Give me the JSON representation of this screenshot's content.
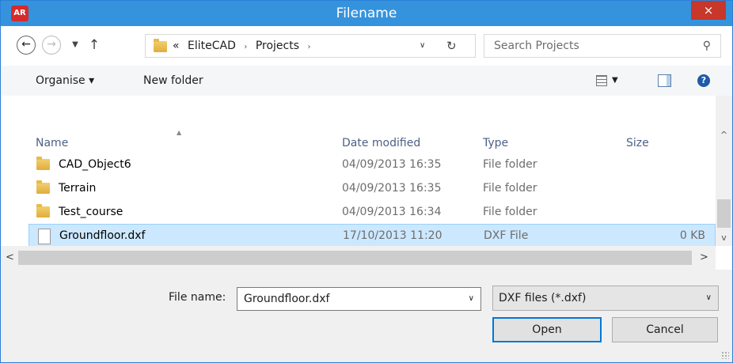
{
  "titlebar": {
    "title": "Filename",
    "app_icon_text": "AR",
    "close_glyph": "×"
  },
  "nav": {
    "back_glyph": "←",
    "forward_glyph": "→",
    "recent_glyph": "▼",
    "up_glyph": "↑"
  },
  "address": {
    "prefix": "«",
    "crumbs": [
      "EliteCAD",
      "Projects"
    ],
    "separator": "›",
    "dropdown_glyph": "∨",
    "refresh_glyph": "↻"
  },
  "search": {
    "placeholder": "Search Projects",
    "icon_glyph": "⚲"
  },
  "toolbar": {
    "organise_label": "Organise ▾",
    "new_folder_label": "New folder",
    "view_dropdown_glyph": "▼",
    "help_glyph": "?"
  },
  "columns": {
    "name": "Name",
    "date": "Date modified",
    "type": "Type",
    "size": "Size",
    "sort_glyph": "▲"
  },
  "rows": [
    {
      "name": "CAD_Object6",
      "date": "04/09/2013 16:35",
      "type": "File folder",
      "size": "",
      "kind": "folder"
    },
    {
      "name": "Terrain",
      "date": "04/09/2013 16:35",
      "type": "File folder",
      "size": "",
      "kind": "folder"
    },
    {
      "name": "Test_course",
      "date": "04/09/2013 16:34",
      "type": "File folder",
      "size": "",
      "kind": "folder"
    },
    {
      "name": "Groundfloor.dxf",
      "date": "17/10/2013 11:20",
      "type": "DXF File",
      "size": "0 KB",
      "kind": "file",
      "selected": true
    }
  ],
  "scroll": {
    "up_glyph": "^",
    "down_glyph": "v",
    "left_glyph": "<",
    "right_glyph": ">"
  },
  "bottom": {
    "filename_label": "File name:",
    "filename_value": "Groundfloor.dxf",
    "filetype_value": "DXF files (*.dxf)",
    "dropdown_glyph": "∨",
    "open_label": "Open",
    "cancel_label": "Cancel"
  },
  "colors": {
    "titlebar": "#3593dd",
    "close": "#c7372a",
    "selection": "#cce8ff",
    "selection_border": "#99d1ff",
    "default_button_border": "#0078d7",
    "header_text": "#4d6185"
  }
}
